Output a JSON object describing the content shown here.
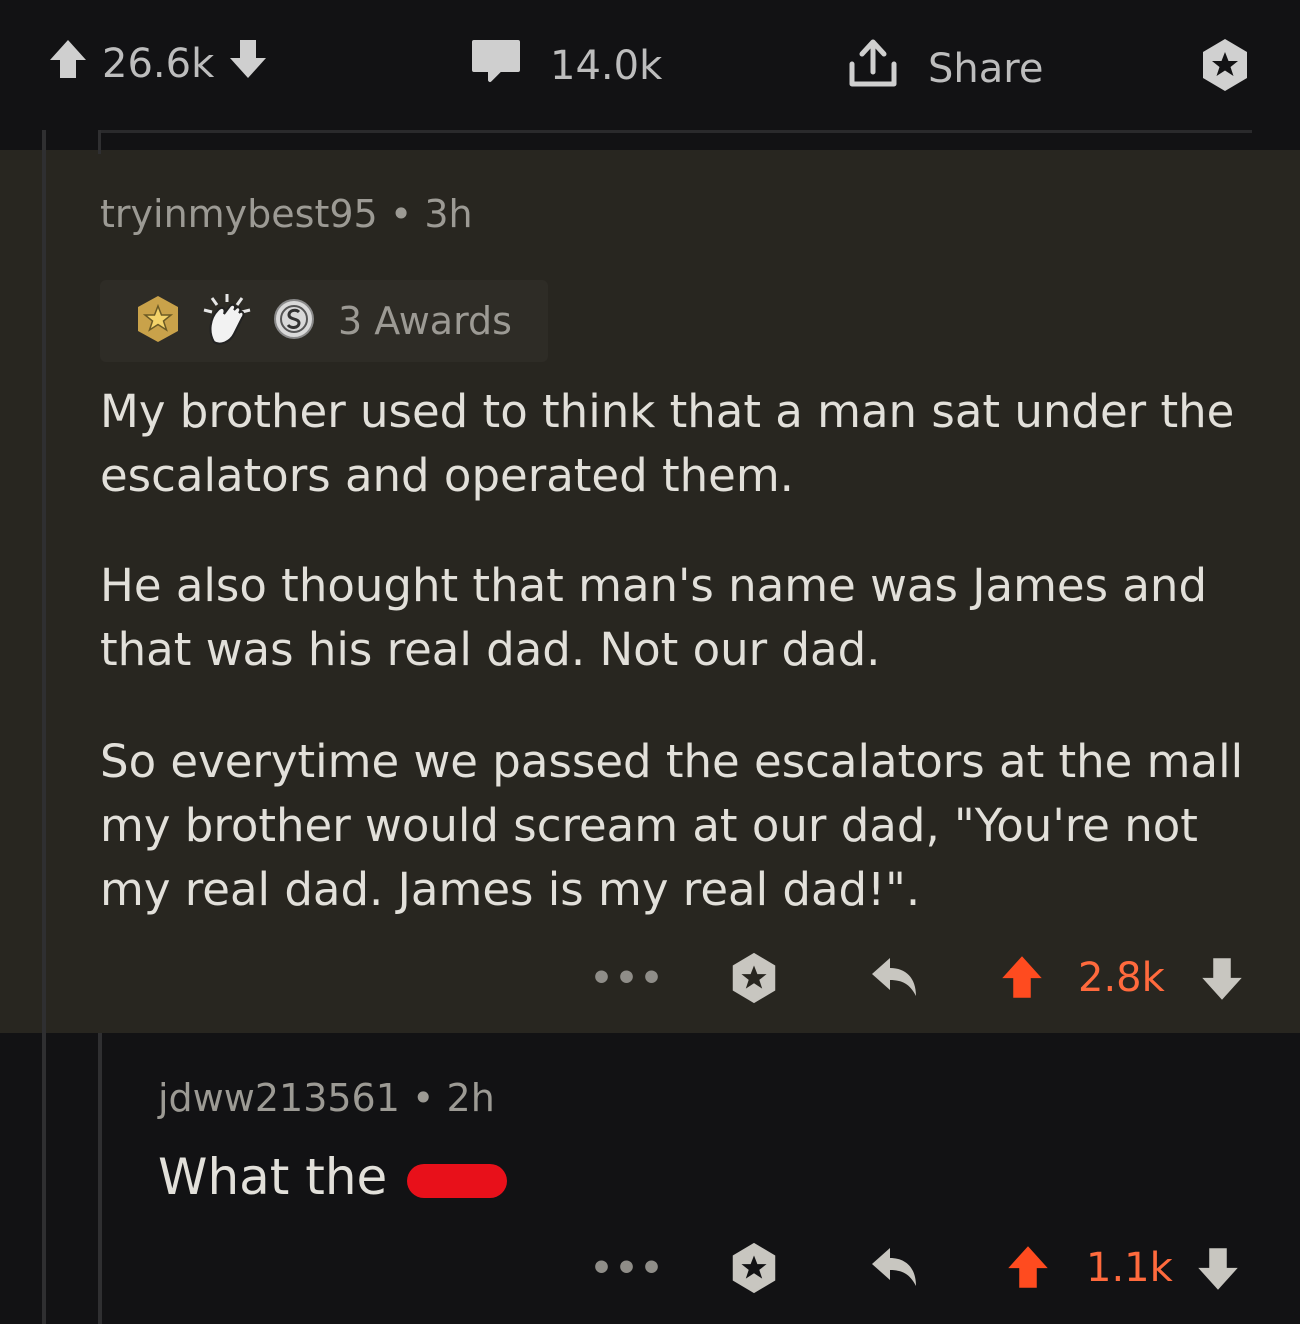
{
  "post_bar": {
    "upvotes": "26.6k",
    "comments": "14.0k",
    "share_label": "Share"
  },
  "comment": {
    "author": "tryinmybest95",
    "separator": "•",
    "age": "3h",
    "awards_label": "3 Awards",
    "paragraphs": [
      "My brother used to think that a man sat under the escalators and operated them.",
      "He also thought that man's name was James and that was his real dad. Not our dad.",
      "So everytime we passed the escalators at the mall my brother would scream at our dad, \"You're not my real dad. James is my real dad!\"."
    ],
    "more": "•••",
    "score": "2.8k"
  },
  "reply": {
    "author": "jdww213561",
    "separator": "•",
    "age": "2h",
    "text": "What the",
    "more": "•••",
    "score": "1.1k"
  },
  "colors": {
    "background": "#121214",
    "highlight": "#282620",
    "upvote_active": "#ff6a3d",
    "redaction": "#e8101a"
  }
}
